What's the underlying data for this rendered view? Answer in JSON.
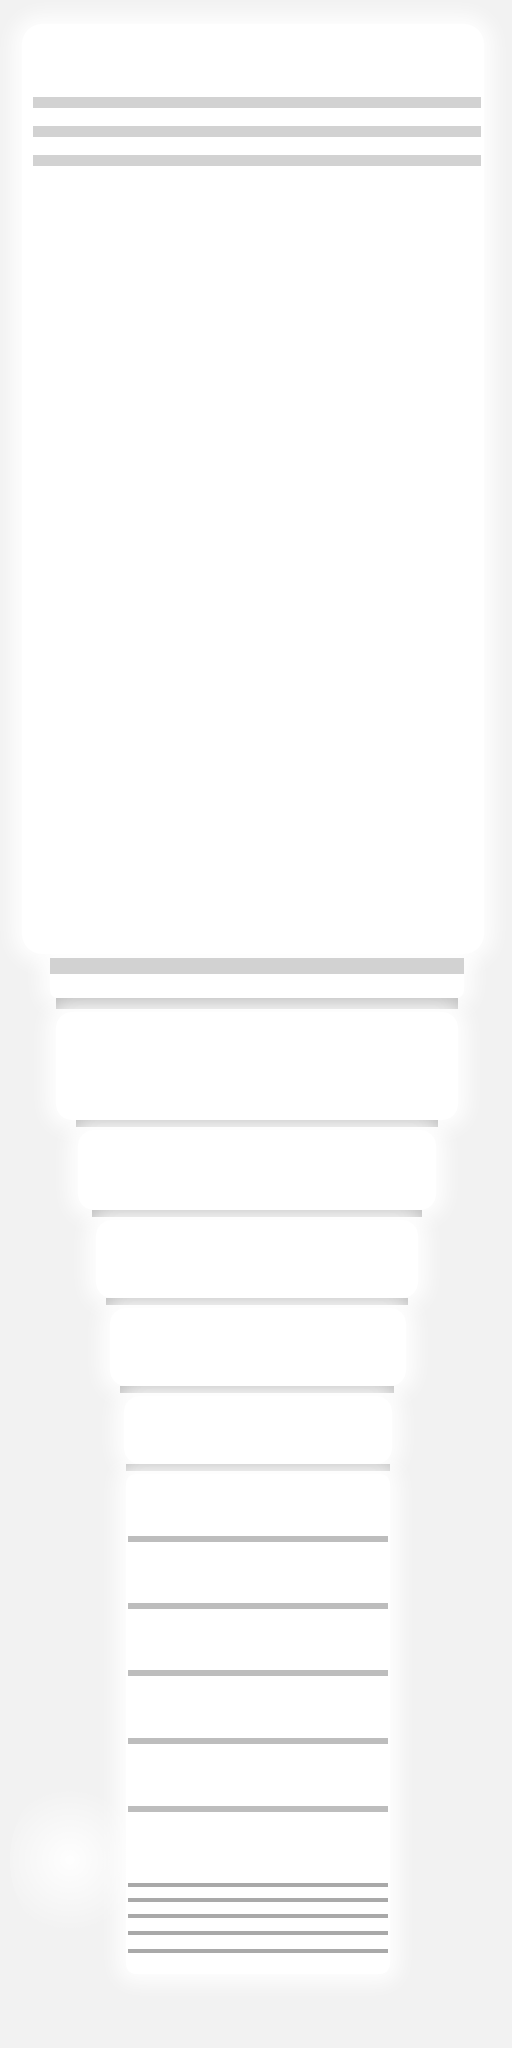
{
  "palette": {
    "background": "#f2f2f2",
    "panel": "#ffffff",
    "rule_light": "#d2d2d2",
    "rule_mid": "#bdbdbd",
    "rule_dark": "#a9a9a9"
  }
}
